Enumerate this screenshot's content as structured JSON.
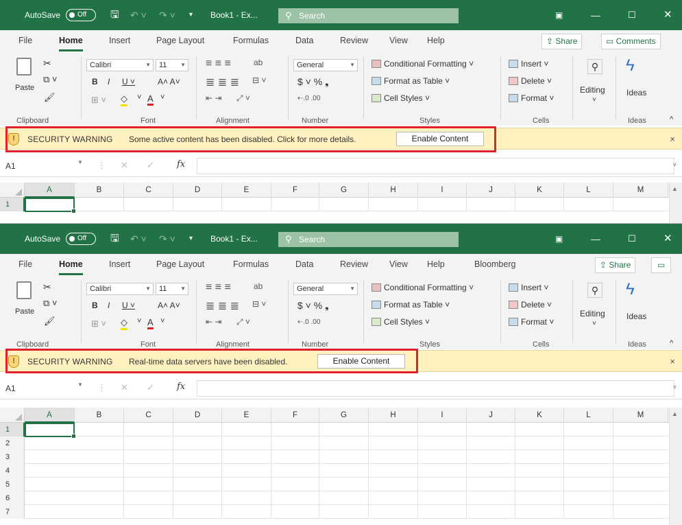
{
  "colors": {
    "excel_green": "#217346",
    "warning_bg": "#fff2c0",
    "highlight_red": "#e0202a"
  },
  "title_bar": {
    "autosave_label": "AutoSave",
    "autosave_state": "Off",
    "book_name": "Book1 - Ex...",
    "search_placeholder": "Search",
    "icons": [
      "save-icon",
      "undo-icon",
      "redo-icon",
      "ribbon-display-icon",
      "minimize-icon",
      "maximize-icon",
      "close-icon"
    ]
  },
  "windows": [
    {
      "tabs": [
        "File",
        "Home",
        "Insert",
        "Page Layout",
        "Formulas",
        "Data",
        "Review",
        "View",
        "Help"
      ],
      "active_tab": "Home",
      "share_label": "Share",
      "comments_label": "Comments",
      "security": {
        "title": "SECURITY WARNING",
        "message": "Some active content has been disabled. Click for more details.",
        "button": "Enable Content",
        "close": "×"
      },
      "name_box": "A1",
      "rows": [
        "1"
      ]
    },
    {
      "tabs": [
        "File",
        "Home",
        "Insert",
        "Page Layout",
        "Formulas",
        "Data",
        "Review",
        "View",
        "Help",
        "Bloomberg"
      ],
      "active_tab": "Home",
      "share_label": "Share",
      "security": {
        "title": "SECURITY WARNING",
        "message": "Real-time data servers have been disabled.",
        "button": "Enable Content",
        "close": "×"
      },
      "name_box": "A1",
      "rows": [
        "1",
        "2",
        "3",
        "4",
        "5",
        "6",
        "7"
      ]
    }
  ],
  "ribbon": {
    "paste": "Paste",
    "font_name": "Calibri",
    "font_size": "11",
    "number_format": "General",
    "styles": [
      "Conditional Formatting",
      "Format as Table",
      "Cell Styles"
    ],
    "cells": [
      "Insert",
      "Delete",
      "Format"
    ],
    "editing": "Editing",
    "ideas": "Ideas",
    "groups": [
      "Clipboard",
      "Font",
      "Alignment",
      "Number",
      "Styles",
      "Cells",
      "Ideas"
    ]
  },
  "formula_bar": {
    "fx": "fx"
  },
  "columns": [
    "A",
    "B",
    "C",
    "D",
    "E",
    "F",
    "G",
    "H",
    "I",
    "J",
    "K",
    "L",
    "M"
  ]
}
